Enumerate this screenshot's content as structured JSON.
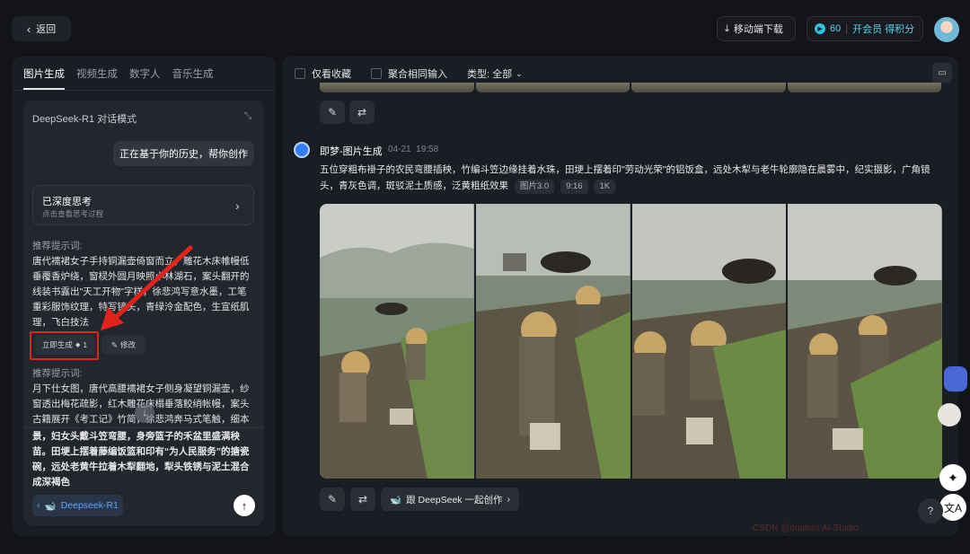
{
  "header": {
    "back_label": "返回",
    "download_label": "移动端下载",
    "points": "60",
    "member_label": "开会员 得积分"
  },
  "left_tabs": [
    "图片生成",
    "视频生成",
    "数字人",
    "音乐生成"
  ],
  "chat": {
    "title": "DeepSeek-R1 对话模式",
    "user_message": "正在基于你的历史，帮你创作",
    "think_title": "已深度思考",
    "think_sub": "点击查看思考过程",
    "prompt1_label": "推荐提示词:",
    "prompt1_text": "唐代襦裙女子手持铜漏壶倚窗而立，雕花木床帷幔低垂覆香炉绕，窗棂外圆月映照小林湖石，案头翻开的线装书露出\"天工开物\"字样，徐悲鸿写意水墨，工笔重彩服饰纹理，特写镜头，青绿泠金配色，生宣纸肌理，飞白技法",
    "generate_now_label": "立即生成",
    "generate_cost": "1",
    "edit_label": "修改",
    "prompt2_label": "推荐提示词:",
    "prompt2_text": "月下仕女图，唐代高腰襦裙女子侧身凝望铜漏壶，纱窗透出梅花疏影，红木雕花床榻垂落鲛绡帐幔，案头古籍展开《考工记》竹简，徐悲鸿奔马式笔触，细本",
    "bottom_text": "景，妇女头戴斗笠弯腰，身旁篮子的禾盆里盛满秧苗。田埂上摆着藤编饭篮和印有“为人民服务”的搪瓷碗，远处老黄牛拉着木犁翻地，犁头铁锈与泥土混合成深褐色",
    "model_label": "Deepseek-R1"
  },
  "filters": {
    "favorites_label": "仅看收藏",
    "merge_label": "聚合相同输入",
    "type_label": "类型: 全部"
  },
  "generation": {
    "title": "即梦-图片生成",
    "date": "04-21",
    "time": "19:58",
    "description": "五位穿粗布褂子的农民弯腰插秧，竹编斗笠边缘挂着水珠，田埂上摆着印\"劳动光荣\"的铝饭盒，远处木犁与老牛轮廓隐在晨雾中，纪实摄影，广角镜头，青灰色调，斑驳泥土质感，泛黄粗纸效果",
    "tags": [
      "图片3.0",
      "9:16",
      "1K"
    ],
    "collab_label": "跟 DeepSeek 一起创作"
  },
  "watermark": "CSDN @doubao AI-Studio"
}
